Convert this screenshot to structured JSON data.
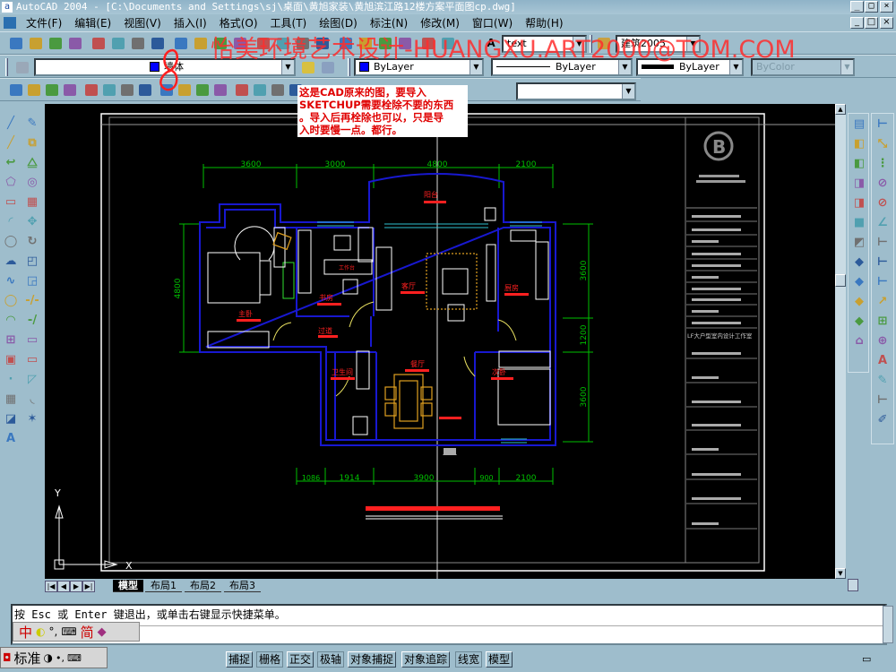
{
  "window": {
    "title": "AutoCAD 2004 - [C:\\Documents and Settings\\sj\\桌面\\黄旭家装\\黄旭滨江路12楼方案平面图cp.dwg]",
    "app_icon": "a"
  },
  "menus": [
    "文件(F)",
    "编辑(E)",
    "视图(V)",
    "插入(I)",
    "格式(O)",
    "工具(T)",
    "绘图(D)",
    "标注(N)",
    "修改(M)",
    "窗口(W)",
    "帮助(H)"
  ],
  "toolbar": {
    "text_style": "text",
    "dim_style": "建筑2005",
    "layer": "墙体",
    "color": "ByLayer",
    "linetype": "ByLayer",
    "lineweight": "ByLayer",
    "plotstyle": "ByColor",
    "view_combo": ""
  },
  "watermark": "怡美环境艺术设计-HUANGXU.ART2000@TOM.COM",
  "note_lines": [
    "这是CAD原来的图，要导入",
    "SKETCHUP需要栓除不要的东西",
    "。导入后再栓除也可以，只是导",
    "入时要慢一点。都行。"
  ],
  "drawing": {
    "dims_top": [
      "3600",
      "3000",
      "4800",
      "2100"
    ],
    "dims_bottom": [
      "1086",
      "1914",
      "3900",
      "900",
      "2100"
    ],
    "dims_left": [
      "4800"
    ],
    "dims_right": [
      "3600",
      "1200",
      "3600"
    ],
    "rooms": {
      "master": "主卧",
      "study": "书房",
      "living": "客厅",
      "kitchen": "厨房",
      "balcony": "阳台",
      "bath": "卫生间",
      "dining": "餐厅",
      "second": "次卧",
      "hall": "过道",
      "desk": "工作台"
    },
    "titleblock_company": "LF大户型室内设计工作室",
    "ucs_x": "X",
    "ucs_y": "Y"
  },
  "tabs": [
    "模型",
    "布局1",
    "布局2",
    "布局3"
  ],
  "command": {
    "line1": "按 Esc 或 Enter 键退出，或单击右键显示快捷菜单。"
  },
  "ime": {
    "mode": "中",
    "charset": "简",
    "style": "标准"
  },
  "status_buttons": [
    {
      "label": "捕捉",
      "on": true
    },
    {
      "label": "栅格",
      "on": false
    },
    {
      "label": "正交",
      "on": true
    },
    {
      "label": "极轴",
      "on": false
    },
    {
      "label": "对象捕捉",
      "on": true
    },
    {
      "label": "对象追踪",
      "on": true
    },
    {
      "label": "线宽",
      "on": false
    },
    {
      "label": "模型",
      "on": true
    }
  ],
  "icons": {
    "tb1": [
      "new-icon",
      "open-icon",
      "save-icon",
      "print-icon",
      "preview-icon",
      "publish-icon",
      "cut-icon",
      "copy-icon",
      "paste-icon",
      "matchprop-icon",
      "undo-icon",
      "redo-icon",
      "pan-icon",
      "zoom-realtime-icon",
      "zoom-window-icon",
      "zoom-previous-icon",
      "properties-icon",
      "designcenter-icon",
      "toolpalette-icon",
      "dbconnect-icon",
      "markup-icon",
      "help-icon"
    ],
    "tb3": [
      "render-icon",
      "scene-icon",
      "lights-icon",
      "materials-icon",
      "mapping-icon",
      "landscape-new-icon",
      "background-icon",
      "fog-icon",
      "landscape-edit-icon",
      "landscape-library-icon",
      "preferences-icon",
      "statistics-icon",
      "3d-orbit-icon",
      "camera-icon",
      "nudge-icon",
      "export-icon"
    ],
    "left1": [
      "line-icon",
      "construction-line-icon",
      "polyline-icon",
      "polygon-icon",
      "rectangle-icon",
      "arc-icon",
      "circle-icon",
      "revcloud-icon",
      "spline-icon",
      "ellipse-icon",
      "ellipse-arc-icon",
      "insert-block-icon",
      "make-block-icon",
      "point-icon",
      "hatch-icon",
      "region-icon",
      "text-icon"
    ],
    "left2": [
      "erase-icon",
      "copy-object-icon",
      "mirror-icon",
      "offset-icon",
      "array-icon",
      "move-icon",
      "rotate-icon",
      "scale-icon",
      "stretch-icon",
      "trim-icon",
      "extend-icon",
      "break-point-icon",
      "break-icon",
      "chamfer-icon",
      "fillet-icon",
      "explode-icon"
    ],
    "right1": [
      "named-views-icon",
      "top-view-icon",
      "bottom-view-icon",
      "left-view-icon",
      "right-view-icon",
      "front-view-icon",
      "back-view-icon",
      "sw-iso-icon",
      "se-iso-icon",
      "ne-iso-icon",
      "nw-iso-icon",
      "camera-view-icon"
    ],
    "right2": [
      "linear-dim-icon",
      "aligned-dim-icon",
      "ordinate-dim-icon",
      "radius-dim-icon",
      "diameter-dim-icon",
      "angular-dim-icon",
      "quick-dim-icon",
      "baseline-dim-icon",
      "continue-dim-icon",
      "leader-icon",
      "tolerance-icon",
      "center-mark-icon",
      "dimedit-icon",
      "dimtedit-icon",
      "dim-update-icon",
      "dim-style-icon"
    ]
  },
  "colors": {
    "wall": "#1010c8",
    "dim": "#00c000",
    "label": "#ff2020",
    "furniture": "#e0a020",
    "watermark": "#ff2d2d"
  }
}
